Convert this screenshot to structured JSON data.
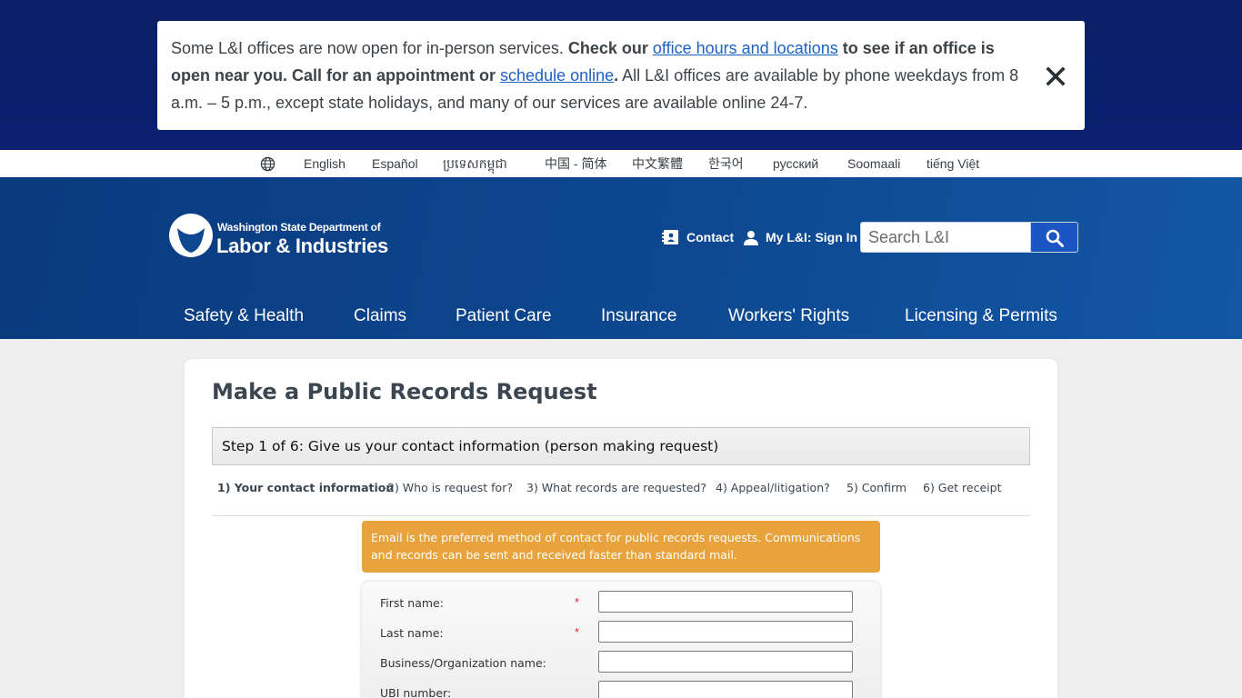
{
  "alert": {
    "part1": "Some L&I offices are now open for in-person services. ",
    "bold1": "Check our ",
    "link1": "office hours and locations",
    "bold2": " to see if an office is open near you. Call for an appointment or ",
    "link2": "schedule online",
    "bold3": ".",
    "part2": " All L&I offices are available by phone weekdays from 8 a.m. – 5 p.m., except state holidays, and many of our services are available online 24-7.",
    "close_icon": "close-x-icon"
  },
  "languages": [
    "English",
    "Español",
    "ប្រទេសកម្ពុជា",
    "中国 - 简体",
    "中文繁體",
    "한국어",
    "русский",
    "Soomaali",
    "tiếng Việt"
  ],
  "header": {
    "logo_line1": "Washington State Department of",
    "logo_line2": "Labor & Industries",
    "contact_label": "Contact",
    "signin_label": "My L&I: Sign In",
    "search_placeholder": "Search L&I"
  },
  "nav": [
    "Safety & Health",
    "Claims",
    "Patient Care",
    "Insurance",
    "Workers' Rights",
    "Licensing & Permits"
  ],
  "main": {
    "title": "Make a Public Records Request",
    "step_heading": "Step 1 of 6: Give us your contact information (person making request)",
    "steps": [
      "1) Your contact information",
      "2) Who is request for?",
      "3) What records are requested?",
      "4) Appeal/litigation?",
      "5) Confirm",
      "6) Get receipt"
    ],
    "notice": "Email is the preferred method of contact for public records requests. Communications and records can be sent and received faster than standard mail.",
    "fields": [
      {
        "label": "First name:",
        "required": "*",
        "value": ""
      },
      {
        "label": "Last name:",
        "required": "*",
        "value": ""
      },
      {
        "label": "Business/Organization name:",
        "required": "",
        "value": ""
      },
      {
        "label": "UBI number:",
        "required": "",
        "value": ""
      }
    ]
  },
  "colors": {
    "alert_band": "#0c1f68",
    "header_blue": "#0d4890",
    "search_button": "#1b55c2",
    "notice_orange": "#e8a33d",
    "link_blue": "#1d61c4",
    "required_red": "#d62a2a"
  }
}
